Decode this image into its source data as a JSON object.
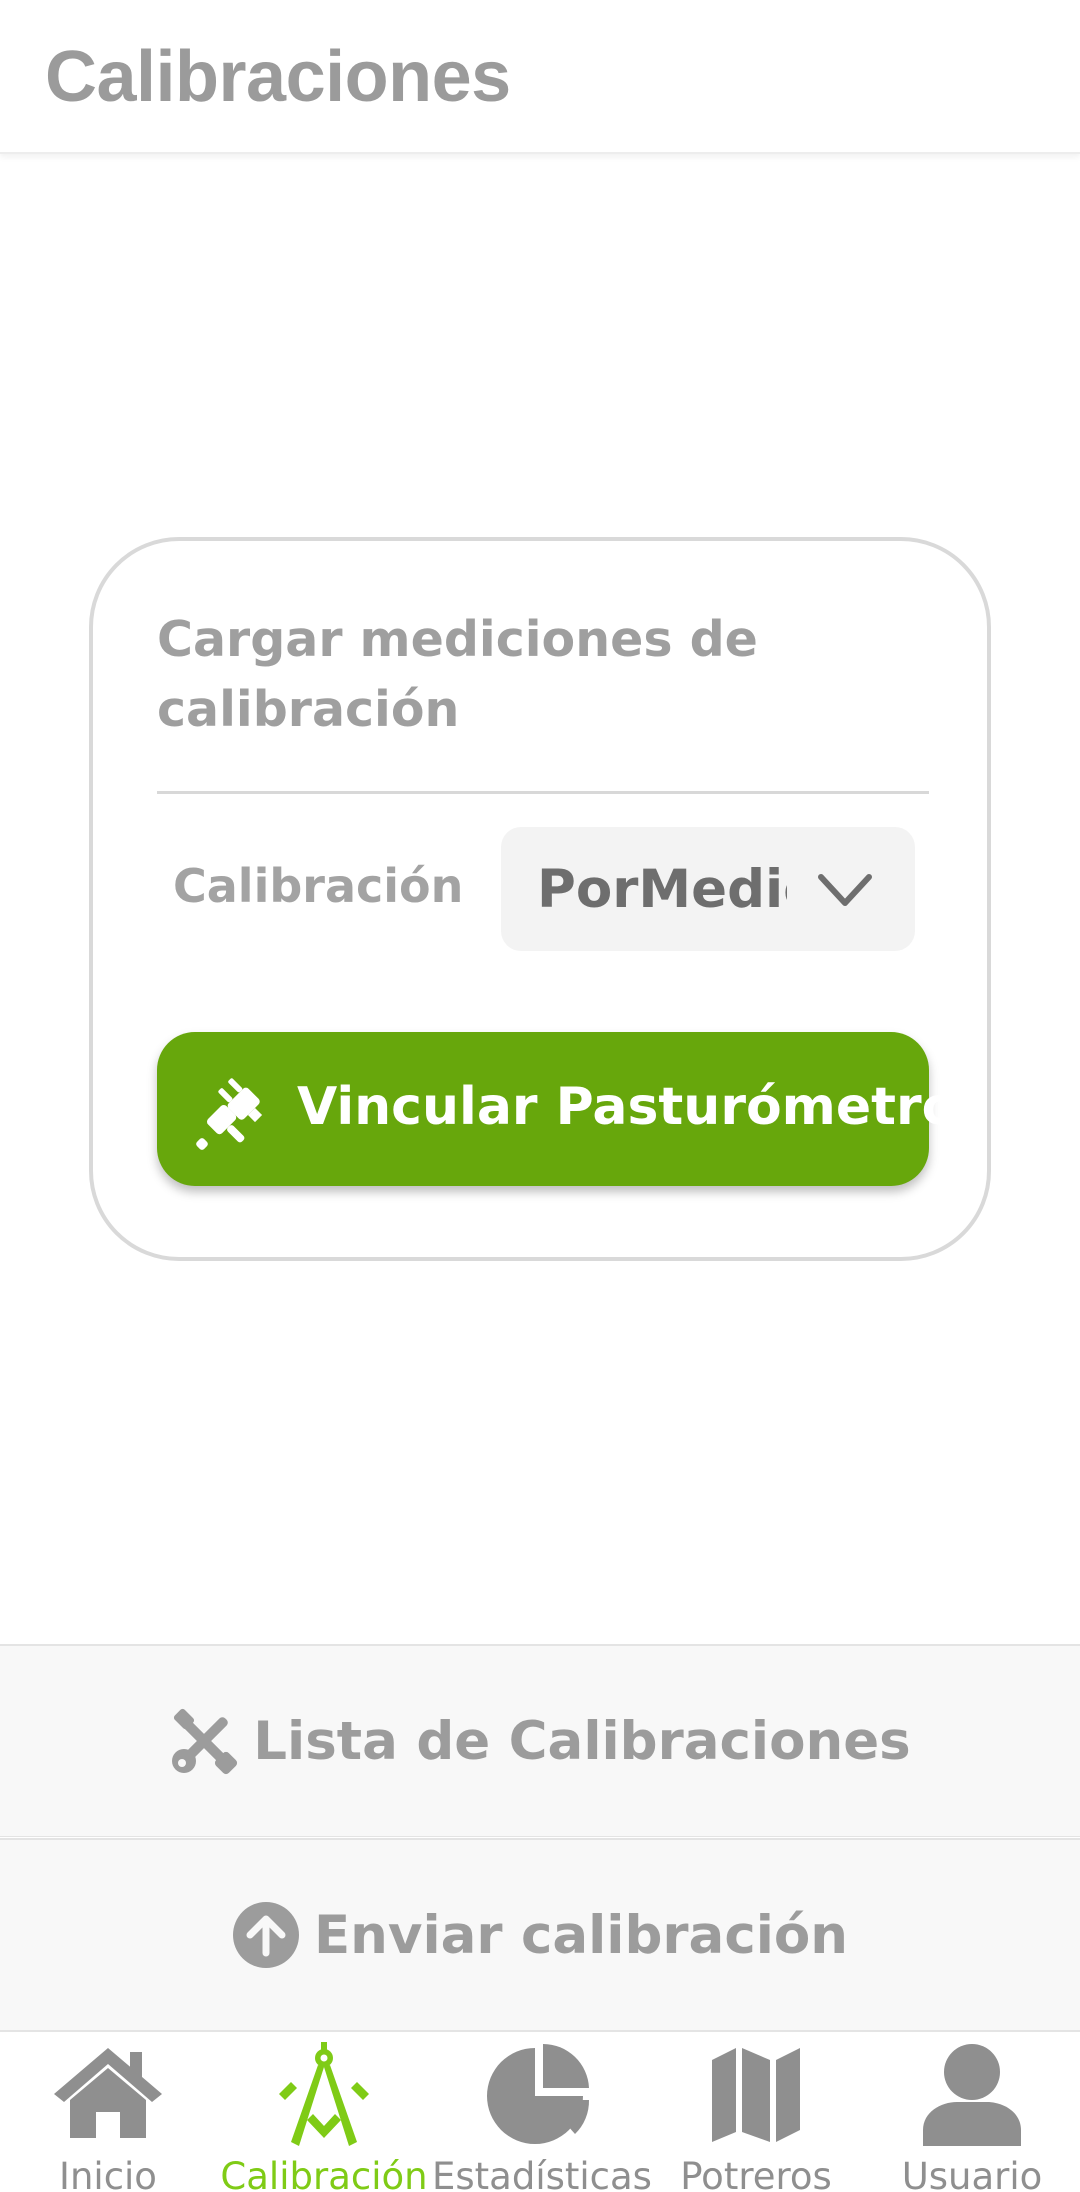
{
  "header": {
    "title": "Calibraciones"
  },
  "card": {
    "title": "Cargar mediciones de calibración",
    "calibration_label": "Calibración",
    "calibration_select": {
      "value": "PorMedic",
      "icon": "chevron-down-icon"
    },
    "link_button": {
      "label": "Vincular Pasturómetro",
      "icon": "plug-icon"
    }
  },
  "actions": {
    "list": {
      "label": "Lista de Calibraciones",
      "icon": "tools-icon"
    },
    "send": {
      "label": "Enviar calibración",
      "icon": "arrow-up-circle-icon"
    }
  },
  "tabbar": {
    "active": "Calibración",
    "tabs": [
      {
        "label": "Inicio",
        "icon": "home-icon"
      },
      {
        "label": "Calibración",
        "icon": "compass-icon"
      },
      {
        "label": "Estadísticas",
        "icon": "pie-chart-icon"
      },
      {
        "label": "Potreros",
        "icon": "map-icon"
      },
      {
        "label": "Usuario",
        "icon": "user-icon"
      }
    ]
  },
  "colors": {
    "accent": "#67a70c",
    "active_tab": "#7fcb16",
    "text_muted": "#9b9b9b",
    "icon": "#8f8f8f"
  }
}
